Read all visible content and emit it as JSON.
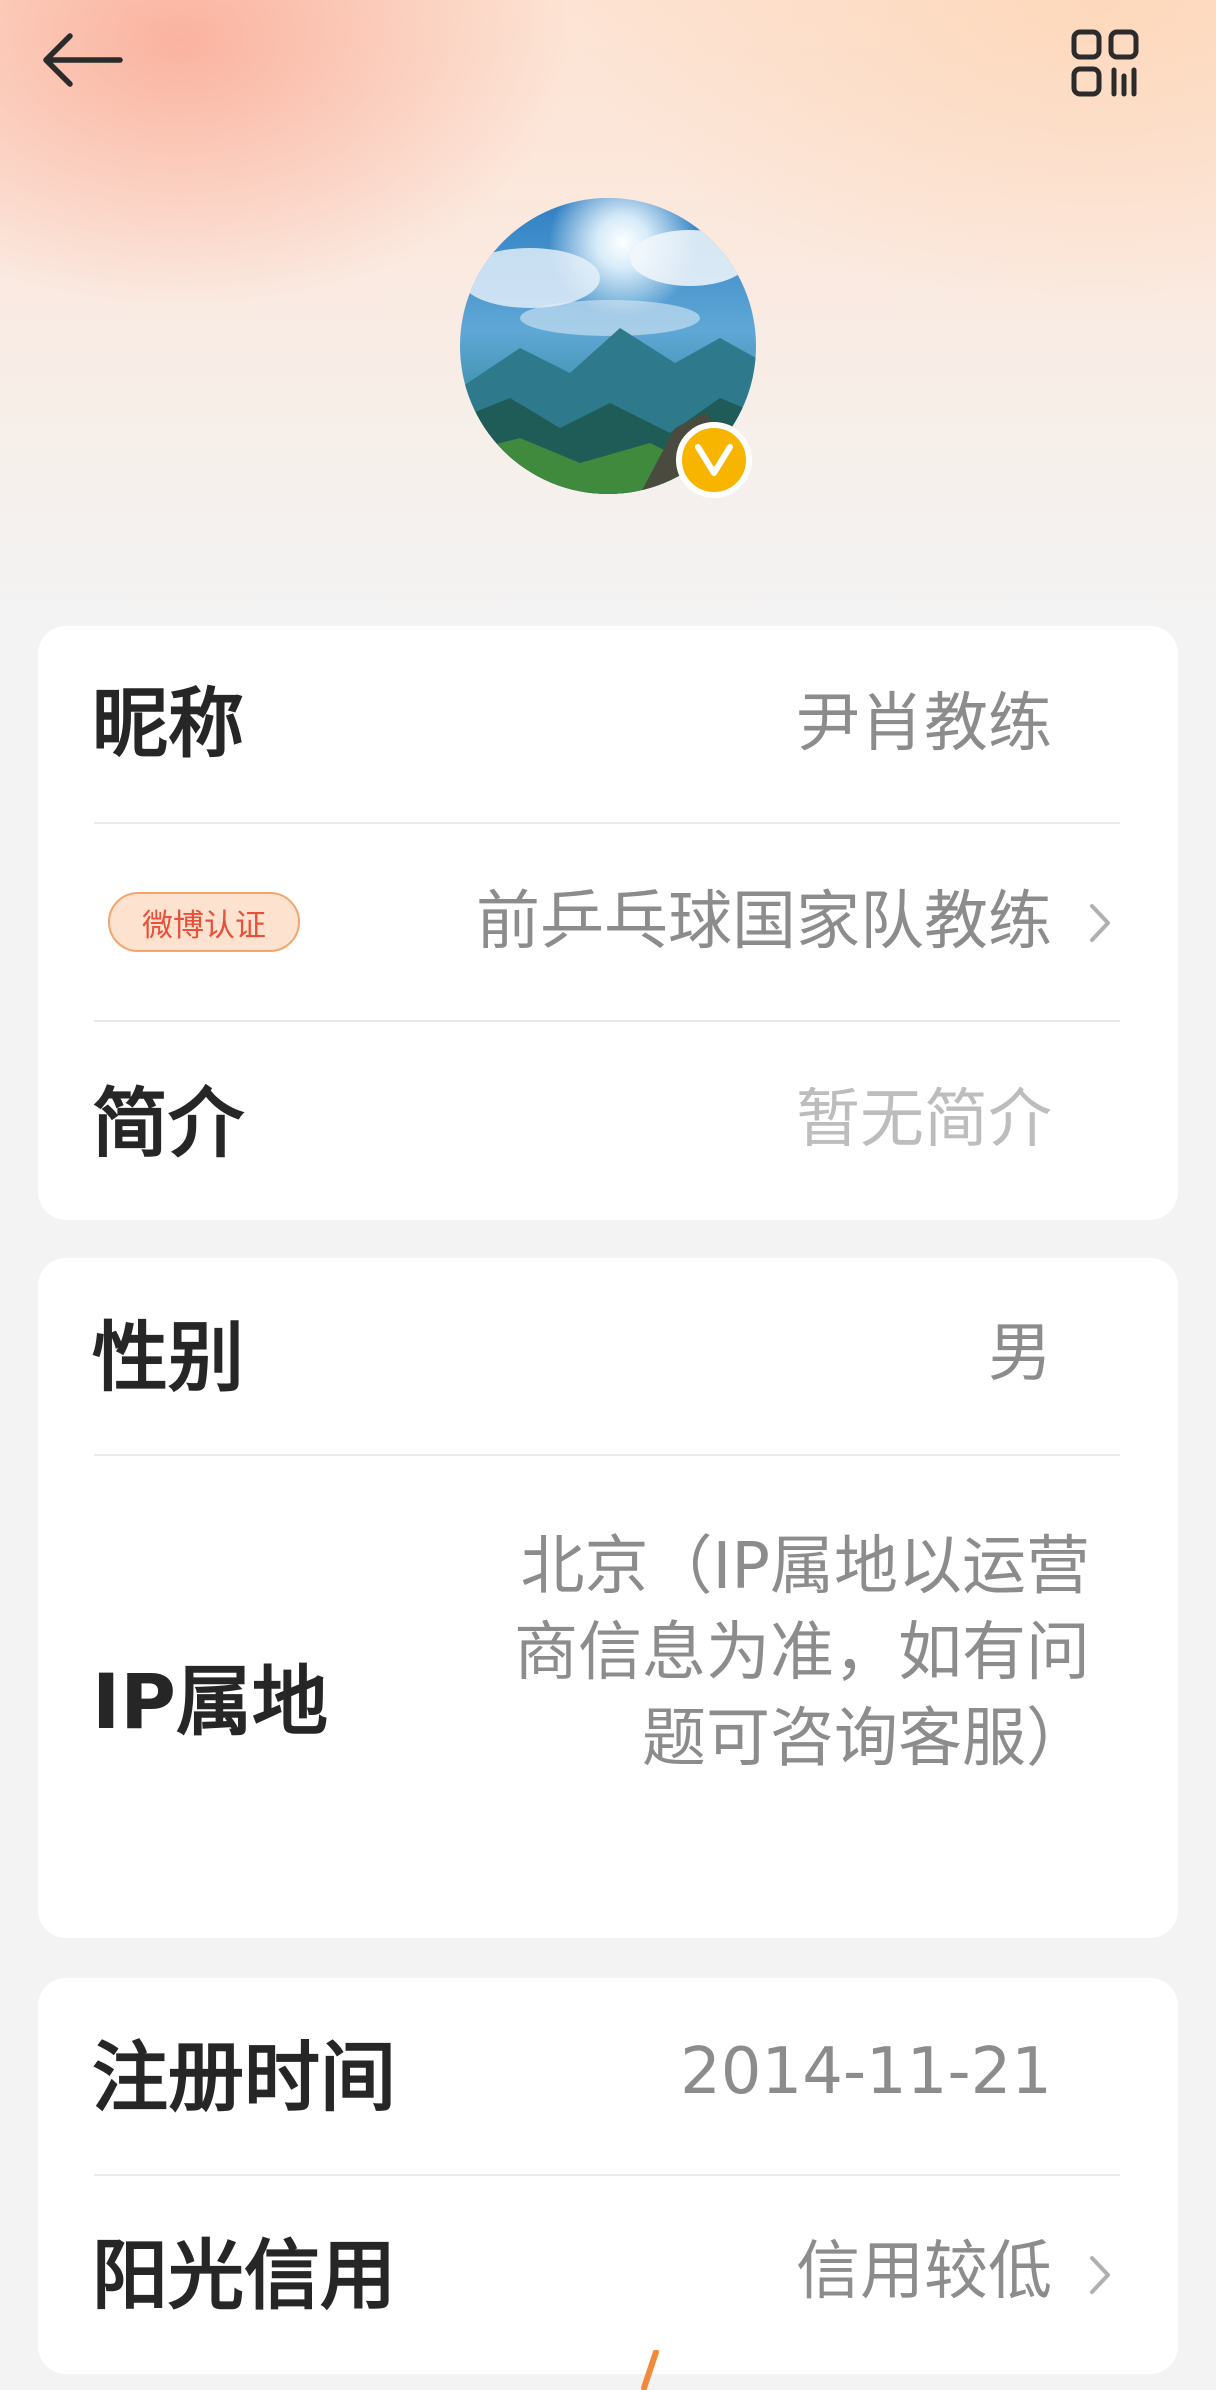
{
  "nav": {
    "back_icon": "arrow-left-icon",
    "qr_icon": "qr-code-icon"
  },
  "avatar": {
    "verified_mark": "V",
    "badge_color": "#f7b500"
  },
  "profile": {
    "nickname_label": "昵称",
    "nickname_value": "尹肖教练",
    "verify_badge": "微博认证",
    "verify_value": "前乒乓球国家队教练",
    "bio_label": "简介",
    "bio_value": "暂无简介",
    "gender_label": "性别",
    "gender_value": "男",
    "ip_label": "IP属地",
    "ip_value": "北京（IP属地以运营商信息为准，如有问题可咨询客服）",
    "register_label": "注册时间",
    "register_value": "2014-11-21",
    "credit_label": "阳光信用",
    "credit_value": "信用较低"
  },
  "colors": {
    "label": "#262626",
    "value": "#8c8c8c",
    "placeholder": "#bdbdbd",
    "badge_text": "#e8503a",
    "badge_bg": "#fde3cf"
  }
}
